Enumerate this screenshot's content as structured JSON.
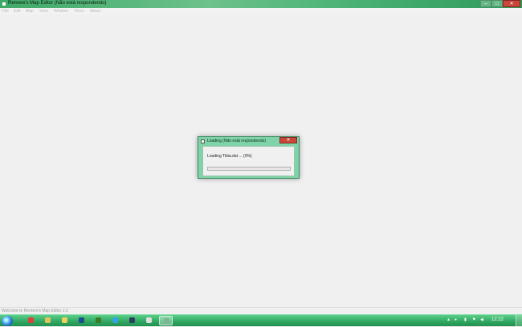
{
  "window": {
    "title": "Remere's Map Editor (Não está respondendo)",
    "minimize_glyph": "–",
    "maximize_glyph": "□",
    "close_glyph": "✕"
  },
  "menu": [
    "File",
    "Edit",
    "Map",
    "View",
    "Window",
    "Floor",
    "About"
  ],
  "status_bar": {
    "text": "Welcome to Remere's Map Editor 2.2"
  },
  "dialog": {
    "title": "Loading (Não está respondendo)",
    "message": "Loading Tibia.dat ... (0%)",
    "progress_percent": 0,
    "close_glyph": "✕",
    "progress_color": "#3bbf4a"
  },
  "taskbar": {
    "start_icon": "windows-start-orb-icon",
    "items": [
      {
        "icon": "chrome-icon",
        "color": "#d9433a"
      },
      {
        "icon": "folder-icon",
        "color": "#e6c25a"
      },
      {
        "icon": "folder-icon",
        "color": "#f1d05e"
      },
      {
        "icon": "photoshop-icon",
        "color": "#1f4f8a"
      },
      {
        "icon": "tibia-icon",
        "color": "#3d7a2a"
      },
      {
        "icon": "skype-icon",
        "color": "#2fa7e0"
      },
      {
        "icon": "steam-icon",
        "color": "#2a3f5a"
      },
      {
        "icon": "app-icon",
        "color": "#e0e0e0"
      },
      {
        "icon": "map-editor-icon",
        "color": "#7bb88f"
      }
    ],
    "clock": "12:22"
  },
  "colors": {
    "title_bar": "#47b072",
    "close_button": "#c9463a",
    "taskbar": "#2fa660"
  }
}
